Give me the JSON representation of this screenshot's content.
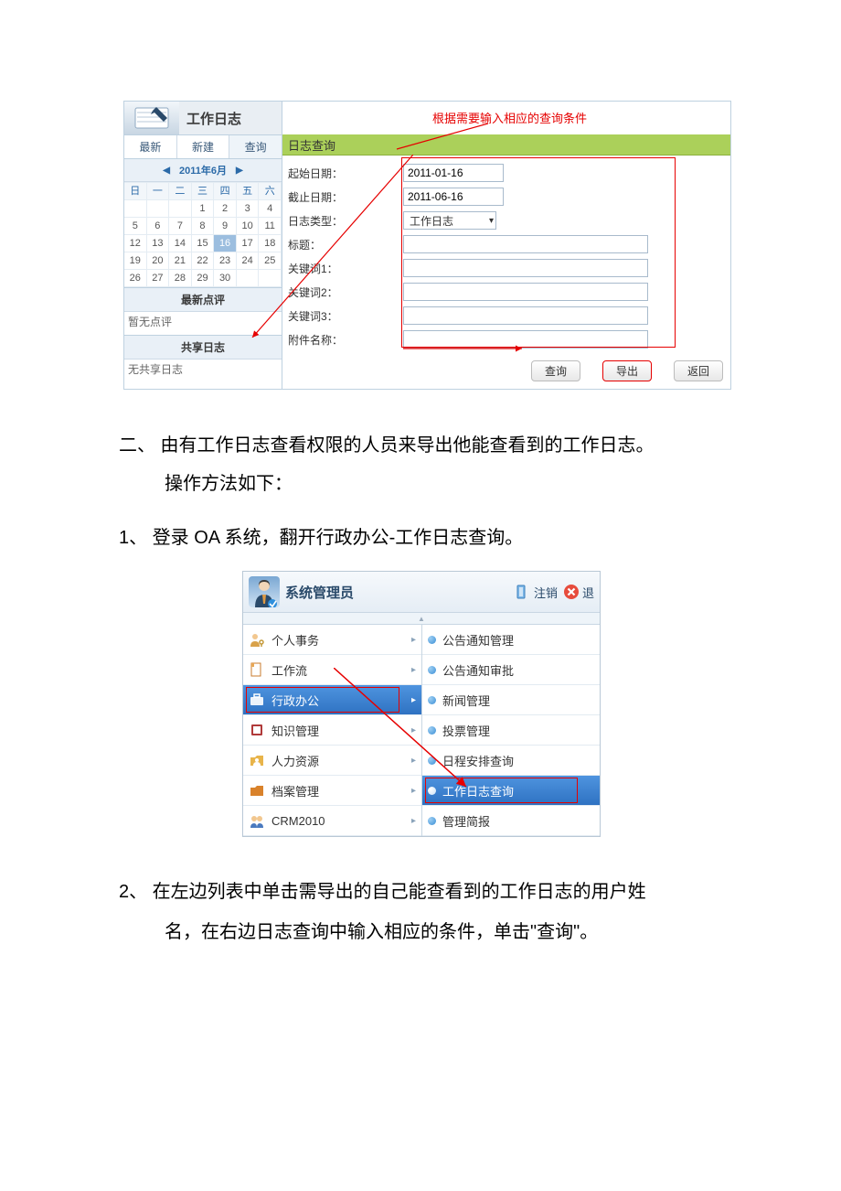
{
  "shot1": {
    "header_title": "工作日志",
    "tabs": {
      "latest": "最新",
      "new": "新建",
      "query": "查询"
    },
    "annotation": "根据需要输入相应的查询条件",
    "green_bar": "日志查询",
    "calendar": {
      "month_label": "2011年6月",
      "dow": [
        "日",
        "一",
        "二",
        "三",
        "四",
        "五",
        "六"
      ],
      "days": [
        "",
        "",
        "",
        "1",
        "2",
        "3",
        "4",
        "5",
        "6",
        "7",
        "8",
        "9",
        "10",
        "11",
        "12",
        "13",
        "14",
        "15",
        "16",
        "17",
        "18",
        "19",
        "20",
        "21",
        "22",
        "23",
        "24",
        "25",
        "26",
        "27",
        "28",
        "29",
        "30",
        "",
        ""
      ],
      "today_index": 18
    },
    "comments": {
      "title": "最新点评",
      "empty": "暂无点评"
    },
    "shared": {
      "title": "共享日志",
      "empty": "无共享日志"
    },
    "form": {
      "start_date_lbl": "起始日期：",
      "start_date_val": "2011-01-16",
      "end_date_lbl": "截止日期：",
      "end_date_val": "2011-06-16",
      "type_lbl": "日志类型：",
      "type_val": "工作日志",
      "title_lbl": "标题：",
      "kw1_lbl": "关键词1：",
      "kw2_lbl": "关键词2：",
      "kw3_lbl": "关键词3：",
      "attach_lbl": "附件名称："
    },
    "buttons": {
      "query": "查询",
      "export": "导出",
      "back": "返回"
    }
  },
  "instructions": {
    "sec2_heading": "二、  由有工作日志查看权限的人员来导出他能查看到的工作日志。",
    "sec2_sub": "操作方法如下：",
    "step1": "1、  登录 OA 系统，翻开行政办公-工作日志查询。",
    "step2_line1": "2、  在左边列表中单击需导出的自己能查看到的工作日志的用户姓",
    "step2_line2": "名，在右边日志查询中输入相应的条件，单击\"查询\"。"
  },
  "shot2": {
    "user_name": "系统管理员",
    "logout": "注销",
    "exit": "退",
    "left_menu": [
      {
        "icon": "person-key",
        "label": "个人事务",
        "chev": true
      },
      {
        "icon": "doc",
        "label": "工作流",
        "chev": true
      },
      {
        "icon": "briefcase",
        "label": "行政办公",
        "chev": true,
        "selected": true,
        "boxed": true
      },
      {
        "icon": "book",
        "label": "知识管理",
        "chev": true
      },
      {
        "icon": "folder-person",
        "label": "人力资源",
        "chev": true
      },
      {
        "icon": "folder",
        "label": "档案管理",
        "chev": true
      },
      {
        "icon": "crm",
        "label": "CRM2010",
        "chev": true
      }
    ],
    "right_menu": [
      {
        "label": "公告通知管理"
      },
      {
        "label": "公告通知审批"
      },
      {
        "label": "新闻管理"
      },
      {
        "label": "投票管理"
      },
      {
        "label": "日程安排查询"
      },
      {
        "label": "工作日志查询",
        "selected": true,
        "boxed": true
      },
      {
        "label": "管理简报"
      }
    ]
  }
}
